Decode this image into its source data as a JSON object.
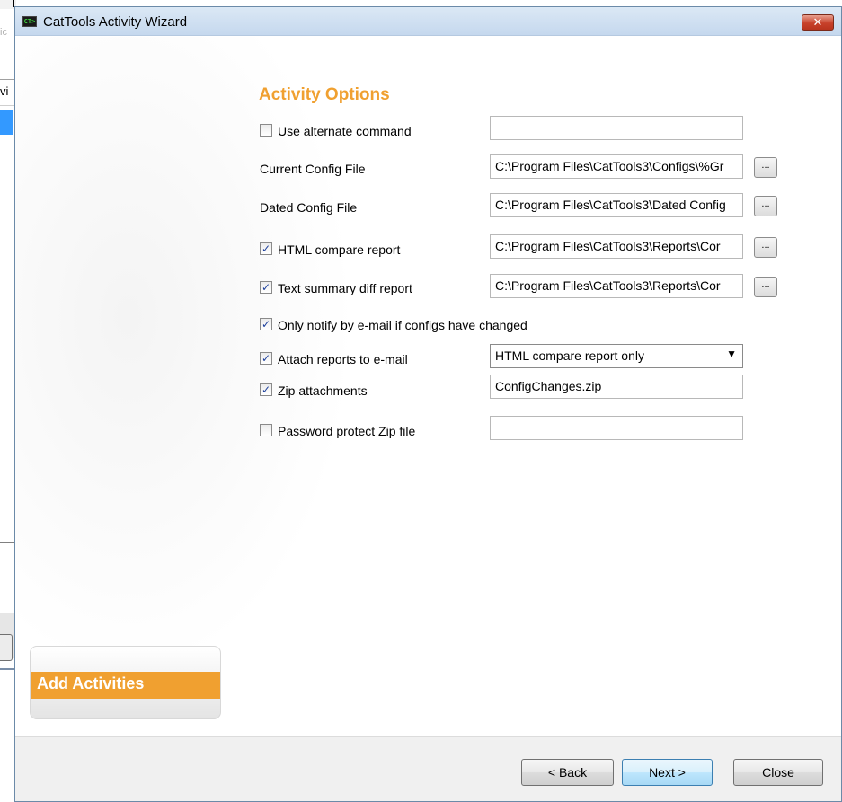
{
  "background": {
    "fragment_1": "ic",
    "fragment_2": "vi"
  },
  "window": {
    "title": "CatTools Activity Wizard",
    "icon_text": "CT>",
    "close_label": "✕"
  },
  "section_title": "Activity Options",
  "options": {
    "use_alternate_command": {
      "label": "Use alternate command",
      "checked": false,
      "value": ""
    },
    "current_config_file": {
      "label": "Current Config File",
      "value": "C:\\Program Files\\CatTools3\\Configs\\%Gr"
    },
    "dated_config_file": {
      "label": "Dated Config File",
      "value": "C:\\Program Files\\CatTools3\\Dated Config"
    },
    "html_compare_report": {
      "label": "HTML compare report",
      "checked": true,
      "value": "C:\\Program Files\\CatTools3\\Reports\\Cor"
    },
    "text_summary_diff_report": {
      "label": "Text summary diff report",
      "checked": true,
      "value": "C:\\Program Files\\CatTools3\\Reports\\Cor"
    },
    "only_notify": {
      "label": "Only notify by e-mail if configs have changed",
      "checked": true
    },
    "attach_reports": {
      "label": "Attach reports to e-mail",
      "checked": true,
      "selected": "HTML compare report only"
    },
    "zip_attachments": {
      "label": "Zip attachments",
      "checked": true,
      "value": "ConfigChanges.zip"
    },
    "password_protect": {
      "label": "Password protect Zip file",
      "checked": false,
      "value": ""
    }
  },
  "browse_label": "...",
  "checkmark": "✓",
  "sidebar": {
    "step_label": "Add Activities"
  },
  "buttons": {
    "back": "< Back",
    "next": "Next >",
    "close": "Close"
  },
  "colors": {
    "accent": "#f0a030",
    "titlebar": "#c5d8ee"
  }
}
